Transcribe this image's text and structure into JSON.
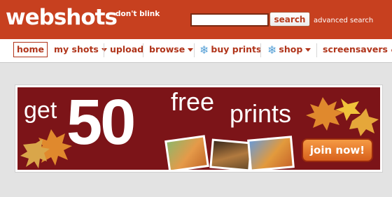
{
  "header": {
    "logo_text": "webshots",
    "tagline": "don't blink",
    "search": {
      "value": "",
      "placeholder": ""
    },
    "search_button": "search",
    "advanced_search": "advanced search"
  },
  "nav": {
    "items": [
      {
        "label": "home",
        "active": true
      },
      {
        "label": "my shots",
        "dropdown": true
      },
      {
        "label": "upload"
      },
      {
        "label": "browse",
        "dropdown": true
      },
      {
        "label": "buy prints",
        "icon": "snowflake-icon"
      },
      {
        "label": "shop",
        "icon": "snowflake-icon",
        "dropdown": true
      },
      {
        "label": "screensavers & w"
      }
    ]
  },
  "banner": {
    "text_get": "get",
    "text_number": "50",
    "text_free": "free",
    "text_prints": "prints",
    "cta": "join now!"
  },
  "colors": {
    "header_bg": "#c7401f",
    "nav_text": "#b0341a",
    "banner_bg": "#7c1418",
    "cta_orange": "#e8782c",
    "page_bg": "#e3e3e3"
  }
}
